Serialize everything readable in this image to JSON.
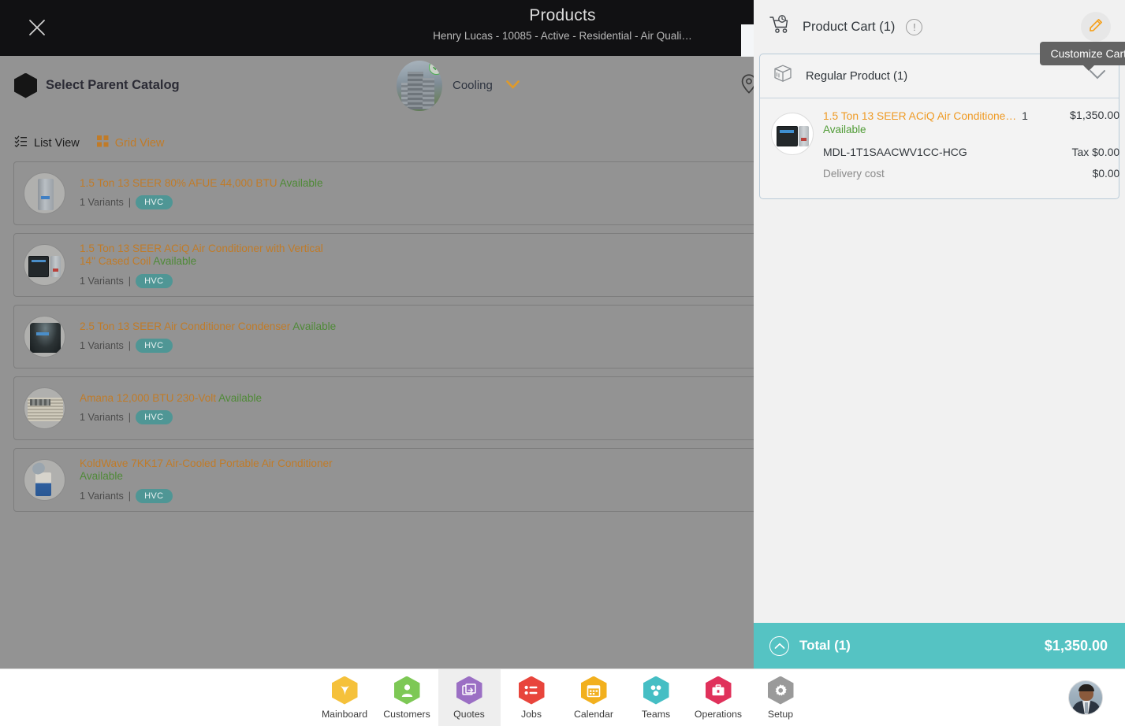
{
  "titlebar": {
    "title": "Products",
    "subtitle": "Henry Lucas - 10085 - Active - Residential - Air Quali…",
    "close_icon": "close-icon",
    "next_icon": "chevron-right-icon"
  },
  "toolbar": {
    "catalog_label": "Select Parent Catalog",
    "catalog_icon": "hexagon-icon",
    "category_label": "Cooling",
    "category_caret": "chevron-down-icon",
    "avatar_badge": "check-icon",
    "location_icon": "location-pin-icon"
  },
  "views": {
    "list_label": "List View",
    "list_icon": "list-view-icon",
    "grid_label": "Grid View",
    "grid_icon": "grid-view-icon",
    "active": "List View"
  },
  "products": [
    {
      "name": "1.5 Ton 13 SEER 80% AFUE 44,000 BTU",
      "status": "Available",
      "variants": "1 Variants",
      "separator": "|",
      "tag": "HVC",
      "thumb": "t-furnace"
    },
    {
      "name": "1.5 Ton 13 SEER ACiQ Air Conditioner with Vertical 14\" Cased Coil",
      "status": "Available",
      "variants": "1 Variants",
      "separator": "|",
      "tag": "HVC",
      "thumb": "t-ac-coil"
    },
    {
      "name": "2.5 Ton 13 SEER Air Conditioner Condenser",
      "status": "Available",
      "variants": "1 Variants",
      "separator": "|",
      "tag": "HVC",
      "thumb": "t-round"
    },
    {
      "name": "Amana 12,000 BTU 230-Volt",
      "status": "Available",
      "variants": "1 Variants",
      "separator": "|",
      "tag": "HVC",
      "thumb": "t-window"
    },
    {
      "name": "KoldWave 7KK17 Air-Cooled Portable Air Conditioner",
      "status": "Available",
      "variants": "1 Variants",
      "separator": "|",
      "tag": "HVC",
      "thumb": "t-portable"
    }
  ],
  "cart": {
    "title": "Product Cart (1)",
    "cart_icon": "shopping-cart-icon",
    "info_icon": "info-circle-icon",
    "info_glyph": "!",
    "edit_icon": "pencil-icon",
    "group_label": "Regular Product (1)",
    "group_icon": "package-box-icon",
    "collapse_icon": "chevron-down-icon",
    "tooltip": "Customize Cart",
    "item": {
      "name": "1.5 Ton 13 SEER ACiQ Air Conditione…",
      "status": "Available",
      "qty": "1",
      "price": "$1,350.00",
      "sku": "MDL-1T1SAACWV1CC-HCG",
      "tax": "Tax $0.00",
      "delivery_label": "Delivery cost",
      "delivery_value": "$0.00"
    },
    "total_label": "Total (1)",
    "total_amount": "$1,350.00",
    "total_icon": "chevron-up-circle-icon"
  },
  "bottomnav": {
    "items": [
      {
        "label": "Mainboard",
        "icon": "mainboard-icon",
        "color": "#f5c13b",
        "selected": false
      },
      {
        "label": "Customers",
        "icon": "person-icon",
        "color": "#7dc855",
        "selected": false
      },
      {
        "label": "Quotes",
        "icon": "quotes-icon",
        "color": "#9b6fc4",
        "selected": true
      },
      {
        "label": "Jobs",
        "icon": "joblist-icon",
        "color": "#e8453c",
        "selected": false
      },
      {
        "label": "Calendar",
        "icon": "calendar-icon",
        "color": "#f2b01e",
        "selected": false
      },
      {
        "label": "Teams",
        "icon": "teams-icon",
        "color": "#45bec4",
        "selected": false
      },
      {
        "label": "Operations",
        "icon": "briefcase-icon",
        "color": "#e0315b",
        "selected": false
      },
      {
        "label": "Setup",
        "icon": "gear-icon",
        "color": "#9a9a9a",
        "selected": false
      }
    ],
    "avatar": "user-avatar"
  },
  "colors": {
    "accent_orange": "#ef9a23",
    "available_green": "#4f9b35",
    "teal": "#55c3c3",
    "tag_teal": "#4f9695",
    "overlay_gray": "#939393",
    "titlebar_black": "#111113"
  }
}
